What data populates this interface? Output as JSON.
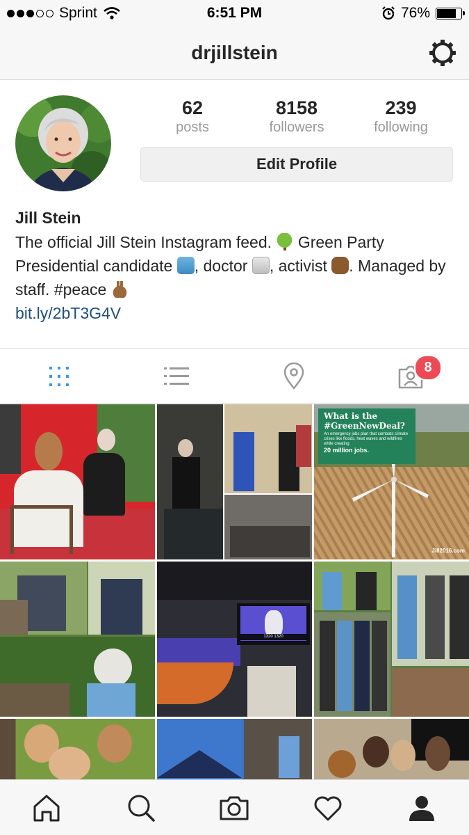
{
  "status_bar": {
    "carrier": "Sprint",
    "time": "6:51 PM",
    "battery": "76%",
    "signal_icon": "signal-dots-icon",
    "wifi_icon": "wifi-icon",
    "alarm_icon": "alarm-clock-icon",
    "battery_level": 0.76
  },
  "header": {
    "username": "drjillstein",
    "settings_icon": "gear-icon"
  },
  "profile": {
    "stats": [
      {
        "value": "62",
        "label": "posts"
      },
      {
        "value": "8158",
        "label": "followers"
      },
      {
        "value": "239",
        "label": "following"
      }
    ],
    "edit_button": "Edit Profile",
    "name": "Jill Stein",
    "bio": {
      "seg1": "The official Jill Stein Instagram feed. ",
      "seg2": " Green Party Presidential candidate ",
      "seg3": ", doctor ",
      "seg4": ", activist ",
      "seg5": ". Managed by staff. #peace "
    },
    "link": "bit.ly/2bT3G4V"
  },
  "tabs": {
    "items": [
      "grid-icon",
      "list-icon",
      "location-pin-icon",
      "tagged-person-icon"
    ],
    "tagged_badge": "8",
    "accent": "#3897f0"
  },
  "grid_posts": {
    "green_new_deal": {
      "title": "What is the #GreenNewDeal?",
      "body": "An emergency jobs plan that combats climate crises like floods, heat waves and wildfires while creating",
      "highlight": "20 million jobs.",
      "watermark": "Jill2016.com"
    },
    "tv_screen_text": "1320 1320"
  },
  "bottom_nav": [
    "home-icon",
    "search-icon",
    "camera-icon",
    "heart-icon",
    "profile-icon"
  ]
}
